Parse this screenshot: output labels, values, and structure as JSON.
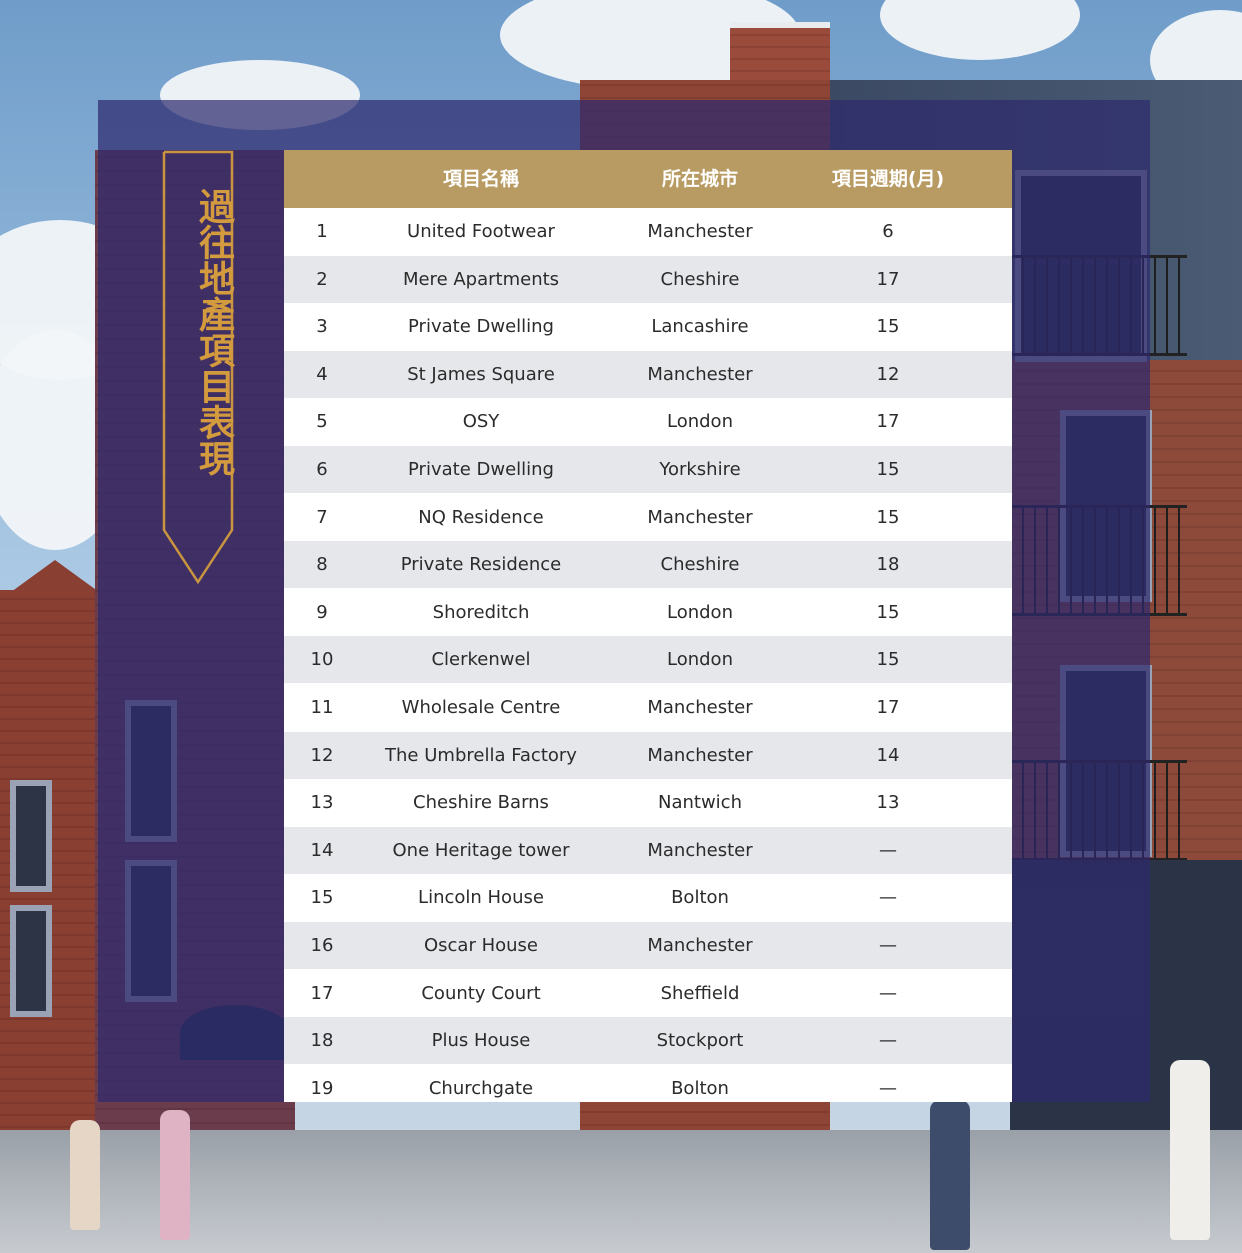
{
  "title": "過往地產項目表現",
  "table": {
    "headers": [
      "",
      "項目名稱",
      "所在城市",
      "項目週期(月)"
    ],
    "rows": [
      [
        "1",
        "United Footwear",
        "Manchester",
        "6"
      ],
      [
        "2",
        "Mere Apartments",
        "Cheshire",
        "17"
      ],
      [
        "3",
        "Private Dwelling",
        "Lancashire",
        "15"
      ],
      [
        "4",
        "St James Square",
        "Manchester",
        "12"
      ],
      [
        "5",
        "OSY",
        "London",
        "17"
      ],
      [
        "6",
        "Private Dwelling",
        "Yorkshire",
        "15"
      ],
      [
        "7",
        "NQ Residence",
        "Manchester",
        "15"
      ],
      [
        "8",
        "Private Residence",
        "Cheshire",
        "18"
      ],
      [
        "9",
        "Shoreditch",
        "London",
        "15"
      ],
      [
        "10",
        "Clerkenwel",
        "London",
        "15"
      ],
      [
        "11",
        "Wholesale Centre",
        "Manchester",
        "17"
      ],
      [
        "12",
        "The Umbrella Factory",
        "Manchester",
        "14"
      ],
      [
        "13",
        "Cheshire Barns",
        "Nantwich",
        "13"
      ],
      [
        "14",
        "One Heritage tower",
        "Manchester",
        "—"
      ],
      [
        "15",
        "Lincoln House",
        "Bolton",
        "—"
      ],
      [
        "16",
        "Oscar House",
        "Manchester",
        "—"
      ],
      [
        "17",
        "County Court",
        "Sheffield",
        "—"
      ],
      [
        "18",
        "Plus House",
        "Stockport",
        "—"
      ],
      [
        "19",
        "Churchgate",
        "Bolton",
        "—"
      ]
    ]
  },
  "colors": {
    "header_bg": "#b89b62",
    "overlay": "#2e2a6e",
    "title": "#d39b3e",
    "row_alt": "#e6e7eb"
  }
}
